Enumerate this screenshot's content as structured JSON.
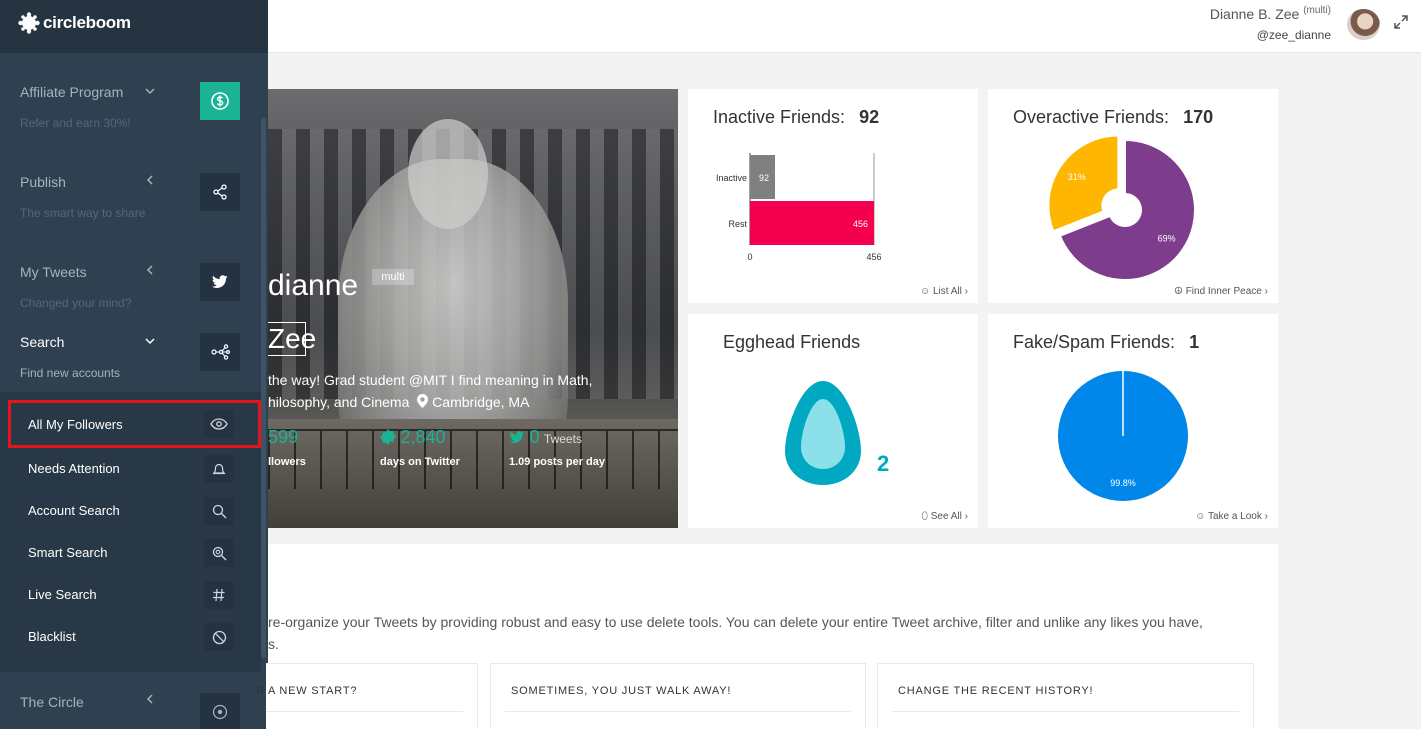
{
  "brand": {
    "name": "circleboom"
  },
  "user": {
    "name": "Dianne B. Zee",
    "tag": "(multi)",
    "handle": "@zee_dianne"
  },
  "sidebar": {
    "sections": [
      {
        "title": "Affiliate Program",
        "subtitle": "Refer and earn 30%!",
        "icon": "dollar-circle-icon"
      },
      {
        "title": "Publish",
        "subtitle": "The smart way to share",
        "icon": "share-icon"
      },
      {
        "title": "My Tweets",
        "subtitle": "Changed your mind?",
        "icon": "twitter-bird-icon"
      },
      {
        "title": "Search",
        "subtitle": "Find new accounts",
        "icon": "network-icon"
      },
      {
        "title": "The Circle",
        "subtitle": "",
        "icon": "circle-icon"
      }
    ],
    "search_items": [
      {
        "label": "All My Followers",
        "icon": "eye-icon"
      },
      {
        "label": "Needs Attention",
        "icon": "bell-icon"
      },
      {
        "label": "Account Search",
        "icon": "search-icon"
      },
      {
        "label": "Smart Search",
        "icon": "zoom-search-icon"
      },
      {
        "label": "Live Search",
        "icon": "hash-icon"
      },
      {
        "label": "Blacklist",
        "icon": "ban-icon"
      }
    ]
  },
  "profile": {
    "name_first": "dianne",
    "name_last": "Zee",
    "badge": "multi",
    "bio_line1": "the way! Grad student @MIT I find meaning in Math,",
    "bio_line2": "hilosophy, and Cinema",
    "location": "Cambridge, MA",
    "stats": [
      {
        "value": "599",
        "unit": "",
        "desc": "llowers"
      },
      {
        "value": "2,840",
        "unit": "",
        "desc": "days on Twitter"
      },
      {
        "value": "0",
        "unit": "Tweets",
        "desc": "1.09 posts per day"
      }
    ]
  },
  "cards": {
    "inactive": {
      "title": "Inactive Friends:",
      "count": "92",
      "link": "List All",
      "chart_data": {
        "type": "bar",
        "categories": [
          "Inactive",
          "Rest"
        ],
        "values": [
          92,
          456
        ],
        "xlim": [
          0,
          456
        ],
        "ticks": [
          "0",
          "456"
        ],
        "colors": [
          "#808080",
          "#f5004f"
        ]
      }
    },
    "overactive": {
      "title": "Overactive Friends:",
      "count": "170",
      "link": "Find Inner Peace",
      "chart_data": {
        "type": "pie",
        "labels": [
          "31%",
          "69%"
        ],
        "values": [
          31,
          69
        ],
        "colors": [
          "#ffb600",
          "#7d3c8c"
        ]
      }
    },
    "egghead": {
      "title": "Egghead Friends",
      "count": "2",
      "link": "See All"
    },
    "fake": {
      "title": "Fake/Spam Friends:",
      "count": "1",
      "link": "Take a Look",
      "chart_data": {
        "type": "pie",
        "labels": [
          "99.8%"
        ],
        "values": [
          99.8,
          0.2
        ],
        "colors": [
          "#0087e9",
          "#0087e9"
        ]
      }
    }
  },
  "bottom": {
    "text_line1": "re-organize your Tweets by providing robust and easy to use delete tools. You can delete your entire Tweet archive, filter and unlike any likes you have,",
    "text_line2": "s.",
    "panels": [
      "R A NEW START?",
      "SOMETIMES, YOU JUST WALK AWAY!",
      "CHANGE THE RECENT HISTORY!"
    ]
  }
}
